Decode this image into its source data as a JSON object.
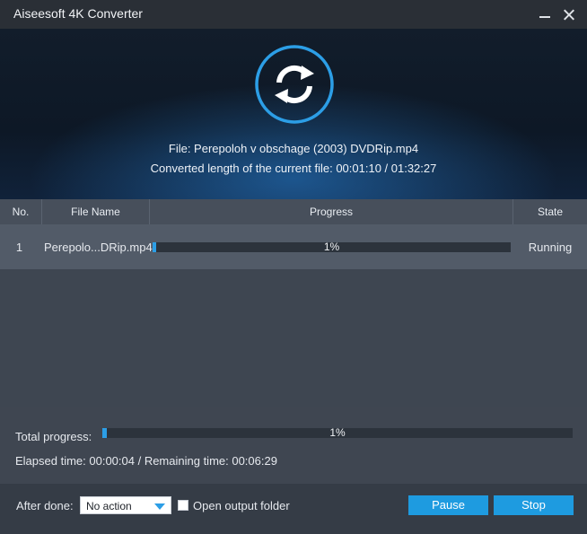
{
  "window": {
    "title": "Aiseesoft 4K Converter"
  },
  "icons": {
    "minimize": "minimize-icon",
    "close": "close-icon",
    "convert": "convert-refresh-icon"
  },
  "colors": {
    "accent": "#2c9ee6",
    "button": "#1e9be0",
    "hero_bg": "#0d1826",
    "ring": "#2c9ee6"
  },
  "hero": {
    "file_line": "File: Perepoloh v obschage (2003) DVDRip.mp4",
    "length_line": "Converted length of the current file: 00:01:10 / 01:32:27"
  },
  "table": {
    "headers": {
      "no": "No.",
      "file_name": "File Name",
      "progress": "Progress",
      "state": "State"
    },
    "rows": [
      {
        "no": "1",
        "file_name": "Perepolo...DRip.mp4",
        "progress_label": "1%",
        "progress": 0.01,
        "state": "Running"
      }
    ]
  },
  "total": {
    "label": "Total progress:",
    "progress_label": "1%",
    "progress": 0.01,
    "elapsed_line": "Elapsed time: 00:00:04 / Remaining time: 00:06:29"
  },
  "footer": {
    "after_done_label": "After done:",
    "after_done_value": "No action",
    "open_folder_label": "Open output folder",
    "open_folder_checked": false,
    "pause_label": "Pause",
    "stop_label": "Stop"
  }
}
